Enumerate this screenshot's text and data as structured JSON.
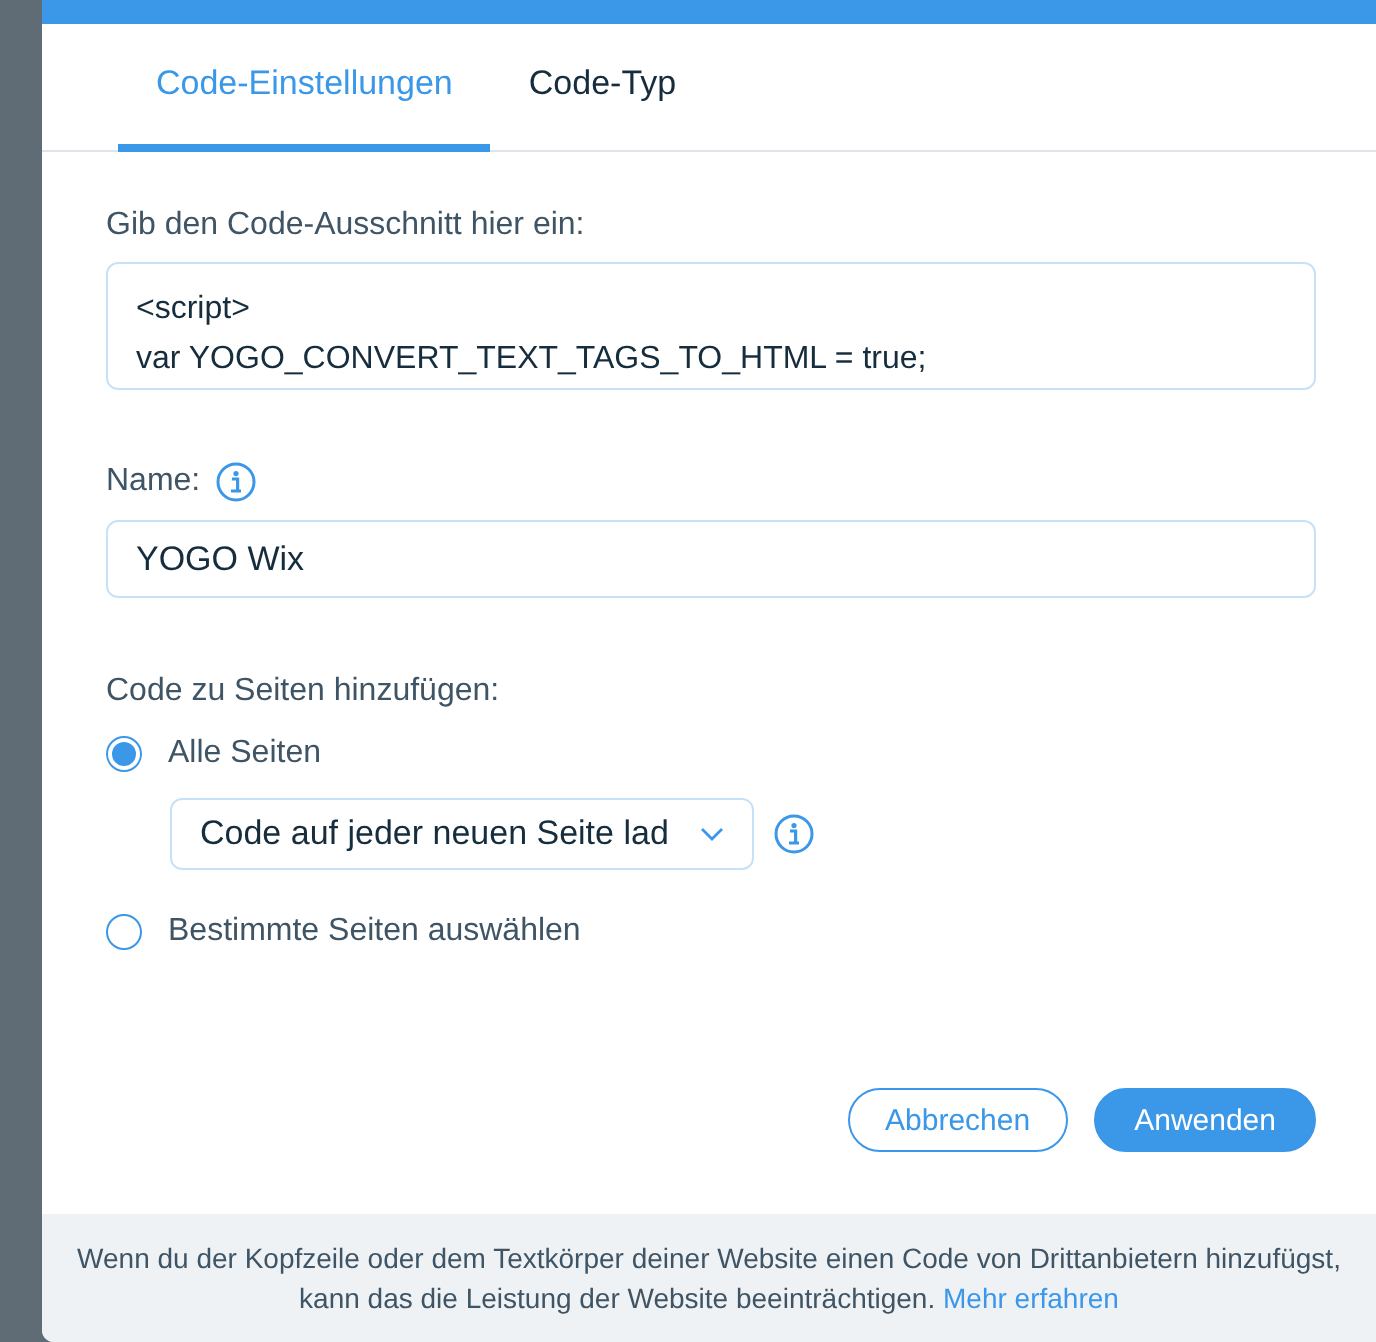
{
  "tabs": [
    {
      "label": "Code-Einstellungen",
      "selected": true
    },
    {
      "label": "Code-Typ",
      "selected": false
    }
  ],
  "snippet": {
    "label": "Gib den Code-Ausschnitt hier ein:",
    "lines": [
      "<script>",
      "var YOGO_CONVERT_TEXT_TAGS_TO_HTML = true;"
    ]
  },
  "name": {
    "label": "Name:",
    "value": "YOGO Wix"
  },
  "pages": {
    "label": "Code zu Seiten hinzufügen:",
    "options": [
      {
        "label": "Alle Seiten",
        "selected": true,
        "dropdown": "Code auf jeder neuen Seite lad"
      },
      {
        "label": "Bestimmte Seiten auswählen",
        "selected": false
      }
    ]
  },
  "buttons": [
    {
      "label": "Abbrechen",
      "kind": "secondary"
    },
    {
      "label": "Anwenden",
      "kind": "primary"
    }
  ],
  "footer": {
    "text": "Wenn du der Kopfzeile oder dem Textkörper deiner Website einen Code von Drittanbietern hinzufügst, kann das die Leistung der Website beeinträchtigen.",
    "link": "Mehr erfahren"
  }
}
